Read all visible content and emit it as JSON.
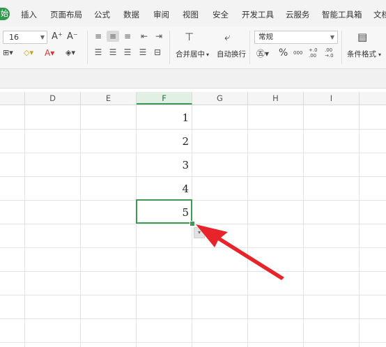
{
  "menu": {
    "home_tab": "始",
    "items": [
      "插入",
      "页面布局",
      "公式",
      "数据",
      "审阅",
      "视图",
      "安全",
      "开发工具",
      "云服务",
      "智能工具箱",
      "文档"
    ]
  },
  "ribbon": {
    "font_size": "16",
    "increase_font": "A⁺",
    "decrease_font": "A⁻",
    "merge_center": "合并居中",
    "auto_wrap": "自动换行",
    "number_format": "常规",
    "percent": "%",
    "thousands": "000",
    "inc_decimal": "+.0 .00",
    "dec_decimal": ".00 →.0",
    "conditional_format": "条件格式"
  },
  "columns": [
    "D",
    "E",
    "F",
    "G",
    "H",
    "I"
  ],
  "selected_column": "F",
  "cells": {
    "f1": "1",
    "f2": "2",
    "f3": "3",
    "f4": "4",
    "f5": "5"
  },
  "colors": {
    "accent": "#3d9a55",
    "arrow": "#e8242b"
  }
}
